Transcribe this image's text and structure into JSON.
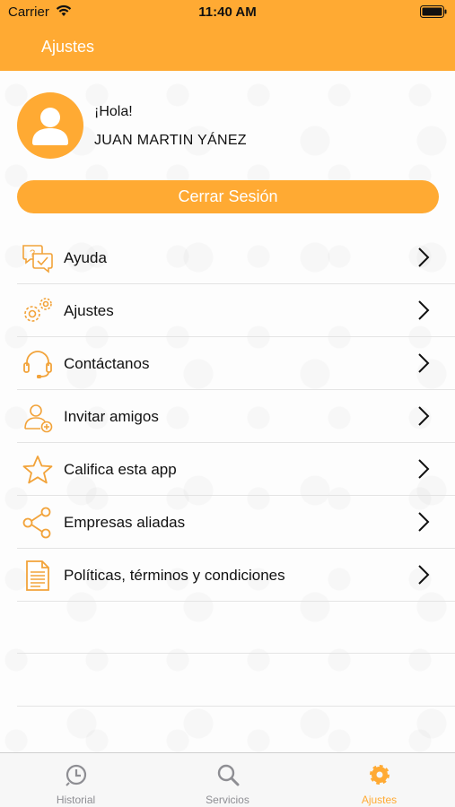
{
  "status_bar": {
    "carrier": "Carrier",
    "time": "11:40 AM"
  },
  "header": {
    "title": "Ajustes"
  },
  "colors": {
    "accent": "#FFAA33",
    "tab_inactive": "#8e8e93"
  },
  "profile": {
    "greeting": "¡Hola!",
    "name": "JUAN MARTIN YÁNEZ"
  },
  "logout_button": {
    "label": "Cerrar Sesión"
  },
  "menu": {
    "items": [
      {
        "label": "Ayuda",
        "icon": "help-chat-icon"
      },
      {
        "label": "Ajustes",
        "icon": "gears-icon"
      },
      {
        "label": "Contáctanos",
        "icon": "headset-icon"
      },
      {
        "label": "Invitar amigos",
        "icon": "add-friend-icon"
      },
      {
        "label": "Califica esta app",
        "icon": "star-icon"
      },
      {
        "label": "Empresas aliadas",
        "icon": "share-icon"
      },
      {
        "label": "Políticas, términos y condiciones",
        "icon": "document-icon"
      }
    ]
  },
  "tabs": [
    {
      "label": "Historial",
      "icon": "clock-icon",
      "active": false
    },
    {
      "label": "Servicios",
      "icon": "search-icon",
      "active": false
    },
    {
      "label": "Ajustes",
      "icon": "gear-icon",
      "active": true
    }
  ]
}
